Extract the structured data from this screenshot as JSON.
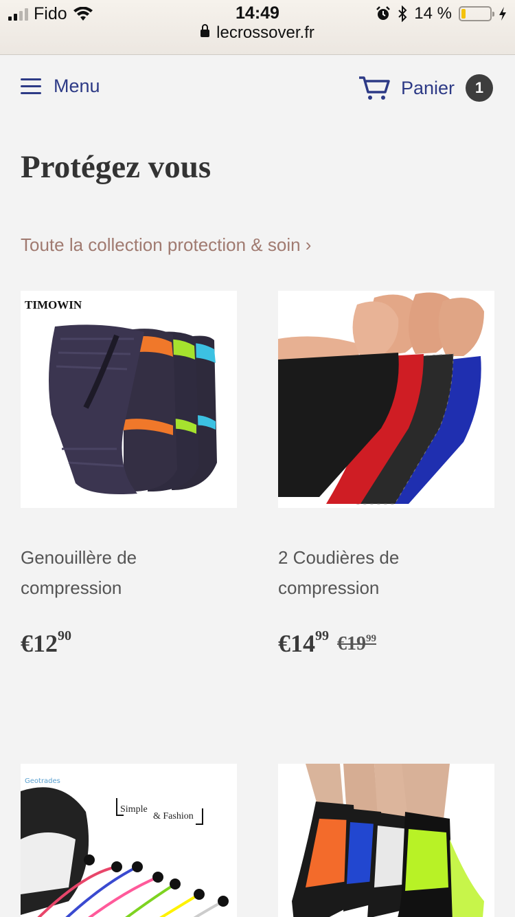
{
  "statusbar": {
    "carrier": "Fido",
    "time": "14:49",
    "url": "lecrossover.fr",
    "battery": "14 %",
    "battery_level": 0.14,
    "icons": [
      "signal-icon",
      "wifi-icon",
      "alarm-icon",
      "bluetooth-icon",
      "battery-icon",
      "charging-icon"
    ]
  },
  "header": {
    "menu_label": "Menu",
    "cart_label": "Panier",
    "cart_count": "1",
    "accent": "#2d3a86"
  },
  "page": {
    "title": "Protégez vous",
    "collection_link": "Toute la collection protection & soin ›",
    "link_color": "#a07a70"
  },
  "products": [
    {
      "name": "Genouillère de compression",
      "price_main": "€12",
      "price_cents": "90",
      "compare_main": "",
      "compare_cents": "",
      "image_brand": "TIMOWIN"
    },
    {
      "name": "2 Coudières de compression",
      "price_main": "€14",
      "price_cents": "99",
      "compare_main": "€19",
      "compare_cents": "99"
    },
    {
      "name": "",
      "image_text_1": "Simple",
      "image_text_2": "& Fashion",
      "image_brand": "Geotrades"
    },
    {
      "name": ""
    }
  ]
}
